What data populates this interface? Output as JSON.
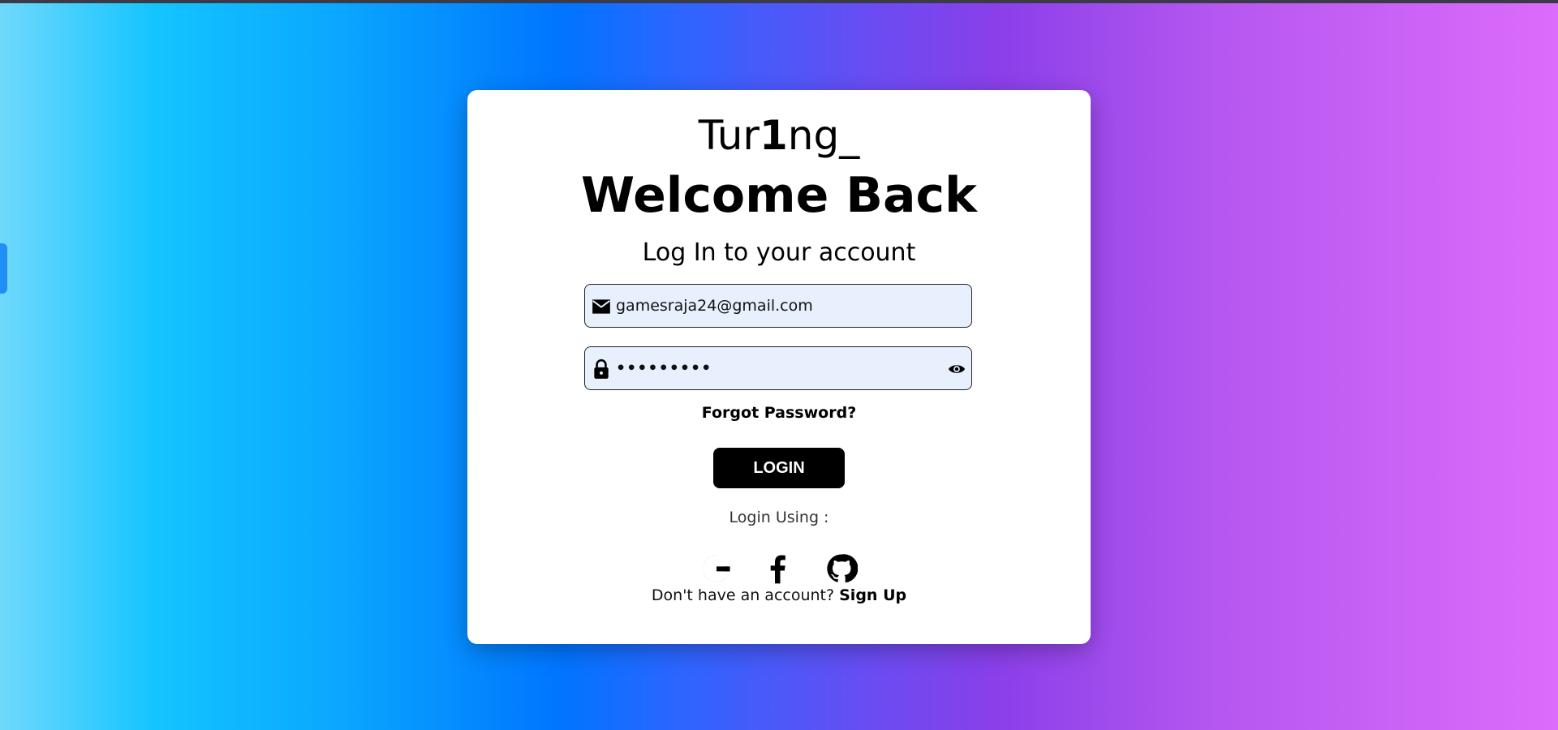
{
  "page": {
    "background_colors": [
      "#6fd8fb",
      "#14c4ff",
      "#0075ff",
      "#8a3fe9",
      "#dc6cfb"
    ]
  },
  "card": {
    "brand_prefix": "Tur",
    "brand_highlight": "1",
    "brand_suffix": "ng_",
    "title": "Welcome Back",
    "subtitle": "Log In to your account"
  },
  "form": {
    "email": {
      "icon": "envelope-icon",
      "value": "gamesraja24@gmail.com"
    },
    "password": {
      "icon": "lock-icon",
      "value": "•••••••••",
      "toggle_icon": "eye-icon"
    },
    "forgot_label": "Forgot Password?",
    "login_label": "LOGIN"
  },
  "social": {
    "label": "Login Using :",
    "providers": [
      {
        "name": "google",
        "icon": "google-icon"
      },
      {
        "name": "facebook",
        "icon": "facebook-icon"
      },
      {
        "name": "github",
        "icon": "github-icon"
      }
    ]
  },
  "signup": {
    "prompt": "Don't have an account?",
    "link_label": "Sign Up"
  }
}
